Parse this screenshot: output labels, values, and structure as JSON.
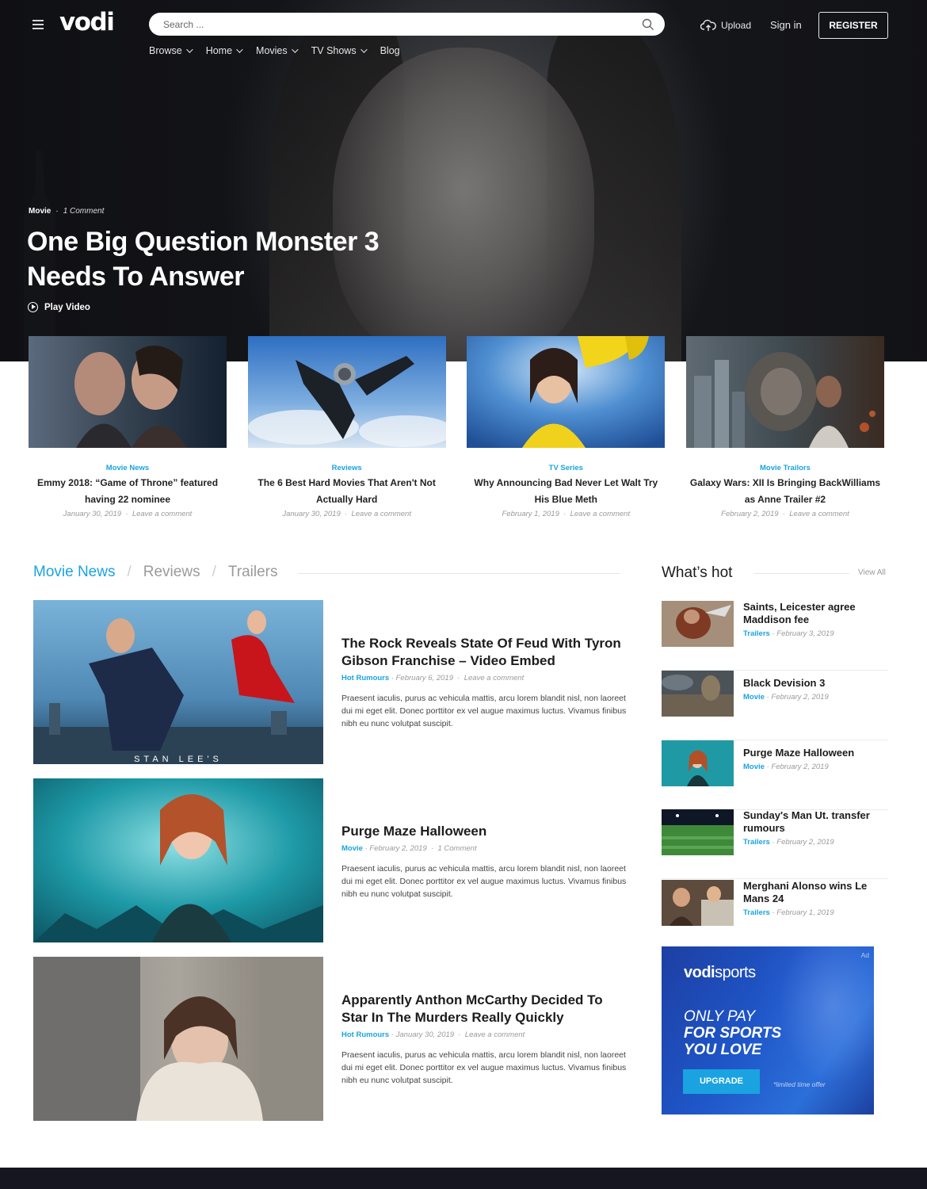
{
  "brand": {
    "logo": "vodi",
    "accent": "#1aa3e0"
  },
  "header": {
    "search_placeholder": "Search ...",
    "upload_label": "Upload",
    "signin_label": "Sign in",
    "register_label": "REGISTER",
    "nav": [
      {
        "label": "Browse",
        "has_dropdown": true
      },
      {
        "label": "Home",
        "has_dropdown": true
      },
      {
        "label": "Movies",
        "has_dropdown": true
      },
      {
        "label": "TV Shows",
        "has_dropdown": true
      },
      {
        "label": "Blog",
        "has_dropdown": false
      }
    ]
  },
  "hero": {
    "category": "Movie",
    "dot": "·",
    "comments": "1 Comment",
    "title": "One Big Question Monster 3 Needs To Answer",
    "play_label": "Play Video"
  },
  "featured": [
    {
      "category": "Movie News",
      "title": "Emmy 2018: “Game of Throne” featured having 22 nominee",
      "date": "January 30, 2019",
      "comment": "Leave a comment"
    },
    {
      "category": "Reviews",
      "title": "The 6 Best Hard Movies That Aren't Not Actually Hard",
      "date": "January 30, 2019",
      "comment": "Leave a comment"
    },
    {
      "category": "TV Series",
      "title": "Why Announcing Bad Never Let Walt Try His Blue Meth",
      "date": "February 1, 2019",
      "comment": "Leave a comment"
    },
    {
      "category": "Movie Trailors",
      "title": "Galaxy Wars: XII Is Bringing BackWilliams as Anne Trailer #2",
      "date": "February 2, 2019",
      "comment": "Leave a comment"
    }
  ],
  "tabs": {
    "items": [
      "Movie News",
      "Reviews",
      "Trailers"
    ],
    "separator": "/"
  },
  "posts": [
    {
      "title": "The Rock Reveals State Of Feud With Tyron Gibson Franchise – Video Embed",
      "category": "Hot Rumours",
      "date": "February 6, 2019",
      "comment": "Leave a comment",
      "excerpt": "Praesent iaculis, purus ac vehicula mattis, arcu lorem blandit nisl, non laoreet dui mi eget elit. Donec porttitor ex vel augue maximus luctus. Vivamus finibus nibh eu nunc volutpat suscipit.",
      "image_caption": "STAN LEE'S"
    },
    {
      "title": "Purge Maze Halloween",
      "category": "Movie",
      "date": "February 2, 2019",
      "comment": "1 Comment",
      "excerpt": "Praesent iaculis, purus ac vehicula mattis, arcu lorem blandit nisl, non laoreet dui mi eget elit. Donec porttitor ex vel augue maximus luctus. Vivamus finibus nibh eu nunc volutpat suscipit."
    },
    {
      "title": "Apparently Anthon McCarthy Decided To Star In The Murders Really Quickly",
      "category": "Hot Rumours",
      "date": "January 30, 2019",
      "comment": "Leave a comment",
      "excerpt": "Praesent iaculis, purus ac vehicula mattis, arcu lorem blandit nisl, non laoreet dui mi eget elit. Donec porttitor ex vel augue maximus luctus. Vivamus finibus nibh eu nunc volutpat suscipit."
    }
  ],
  "sidebar": {
    "title": "What’s hot",
    "view_all": "View All",
    "items": [
      {
        "title": "Saints, Leicester agree Maddison fee",
        "category": "Trailers",
        "date": "February 3, 2019"
      },
      {
        "title": "Black Devision 3",
        "category": "Movie",
        "date": "February 2, 2019"
      },
      {
        "title": "Purge Maze Halloween",
        "category": "Movie",
        "date": "February 2, 2019"
      },
      {
        "title": "Sunday's Man Ut. transfer rumours",
        "category": "Trailers",
        "date": "February 2, 2019"
      },
      {
        "title": "Merghani Alonso wins Le Mans 24",
        "category": "Trailers",
        "date": "February 1, 2019"
      }
    ]
  },
  "ad": {
    "label": "Ad",
    "logo_bold": "vodi",
    "logo_light": "sports",
    "slogan_1": "ONLY PAY",
    "slogan_2": "FOR SPORTS",
    "slogan_3": "YOU LOVE",
    "button": "UPGRADE",
    "note": "*limited time offer"
  }
}
